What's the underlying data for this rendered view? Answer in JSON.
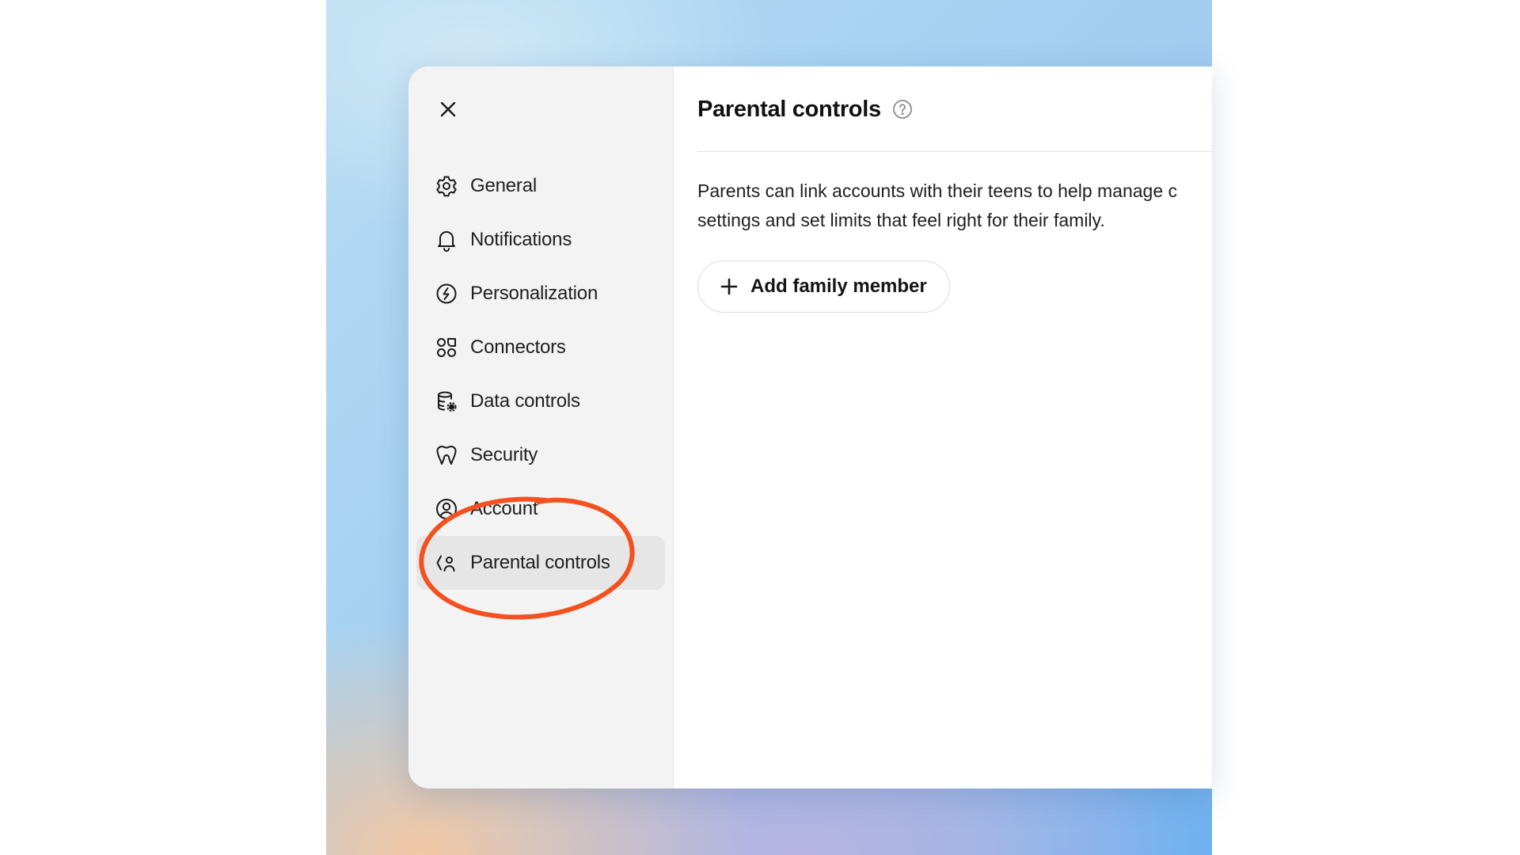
{
  "sidebar": {
    "close_icon": "close-icon",
    "items": [
      {
        "label": "General",
        "icon": "gear-icon",
        "active": false
      },
      {
        "label": "Notifications",
        "icon": "bell-icon",
        "active": false
      },
      {
        "label": "Personalization",
        "icon": "personalization-icon",
        "active": false
      },
      {
        "label": "Connectors",
        "icon": "connectors-icon",
        "active": false
      },
      {
        "label": "Data controls",
        "icon": "database-gear-icon",
        "active": false
      },
      {
        "label": "Security",
        "icon": "shield-icon",
        "active": false
      },
      {
        "label": "Account",
        "icon": "user-circle-icon",
        "active": false
      },
      {
        "label": "Parental controls",
        "icon": "parental-controls-icon",
        "active": true
      }
    ]
  },
  "main": {
    "title": "Parental controls",
    "help_icon": "question-circle-icon",
    "description": "Parents can link accounts with their teens to help manage c\nsettings and set limits that feel right for their family.",
    "add_button": {
      "icon": "plus-icon",
      "label": "Add family member"
    }
  },
  "annotation": {
    "type": "hand-drawn-circle",
    "color": "#f4511e",
    "target": "Parental controls"
  }
}
